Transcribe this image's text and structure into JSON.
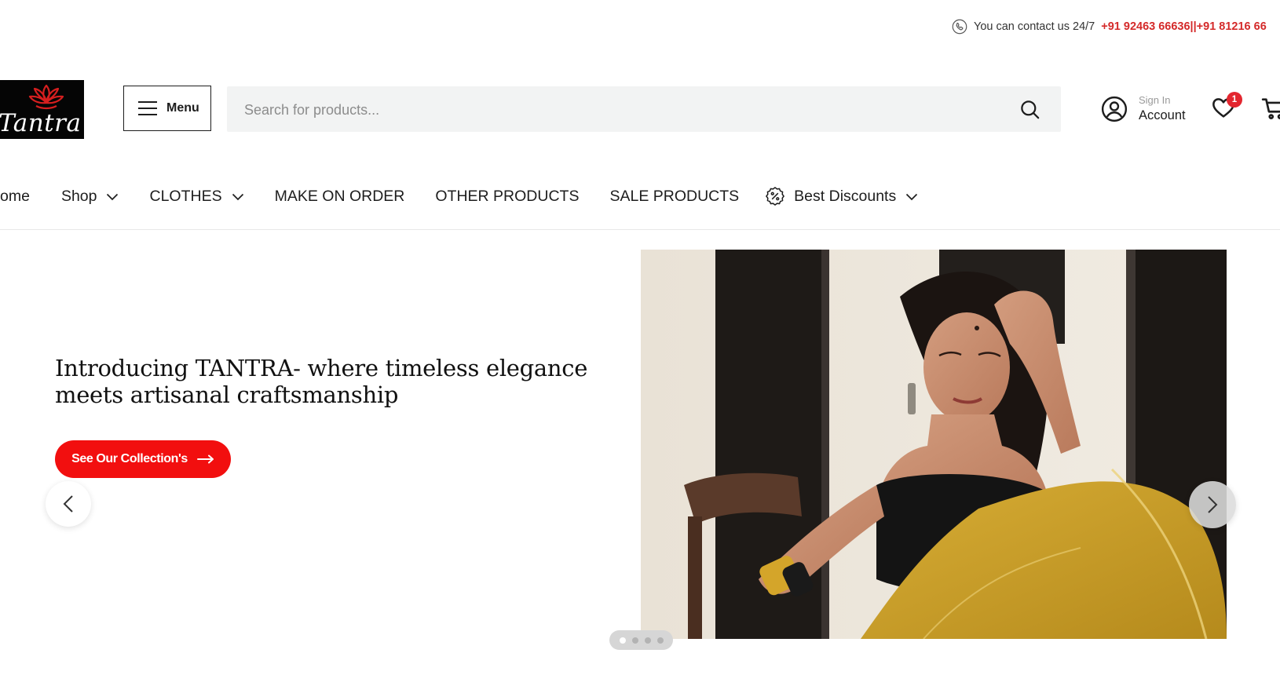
{
  "topbar": {
    "contact_text": "You can contact us 24/7",
    "phone_1": "+91 92463 66636",
    "separator": "||",
    "phone_2": "+91 81216 66"
  },
  "header": {
    "logo_text": "Tantra",
    "menu_label": "Menu",
    "search_placeholder": "Search for products...",
    "account_small": "Sign In",
    "account_big": "Account",
    "wishlist_count": "1"
  },
  "nav": {
    "items": [
      {
        "label": "Home",
        "visible_text": "ome",
        "has_dropdown": false
      },
      {
        "label": "Shop",
        "visible_text": "Shop",
        "has_dropdown": true
      },
      {
        "label": "CLOTHES",
        "visible_text": "CLOTHES",
        "has_dropdown": true
      },
      {
        "label": "MAKE ON ORDER",
        "visible_text": "MAKE ON ORDER",
        "has_dropdown": false
      },
      {
        "label": "OTHER PRODUCTS",
        "visible_text": "OTHER PRODUCTS",
        "has_dropdown": false
      },
      {
        "label": "SALE PRODUCTS",
        "visible_text": "SALE PRODUCTS",
        "has_dropdown": false
      },
      {
        "label": "Best Discounts",
        "visible_text": "Best Discounts",
        "has_dropdown": true
      }
    ]
  },
  "hero": {
    "headline_line1": "Introducing TANTRA- where timeless elegance",
    "headline_line2": "meets artisanal craftsmanship",
    "cta_label": "See Our Collection's",
    "slide_count": 4,
    "active_slide": 1
  },
  "colors": {
    "accent_red": "#f20f0f",
    "phone_red": "#d42a2a",
    "badge_red": "#e3262f",
    "search_bg": "#f2f3f3",
    "saree_mustard": "#c9a12a"
  },
  "icons": [
    "phone-icon",
    "lotus-icon",
    "hamburger-icon",
    "search-icon",
    "user-icon",
    "heart-icon",
    "cart-icon",
    "chevron-down-icon",
    "percent-badge-icon",
    "arrow-right-icon",
    "chevron-left-icon",
    "chevron-right-icon"
  ]
}
